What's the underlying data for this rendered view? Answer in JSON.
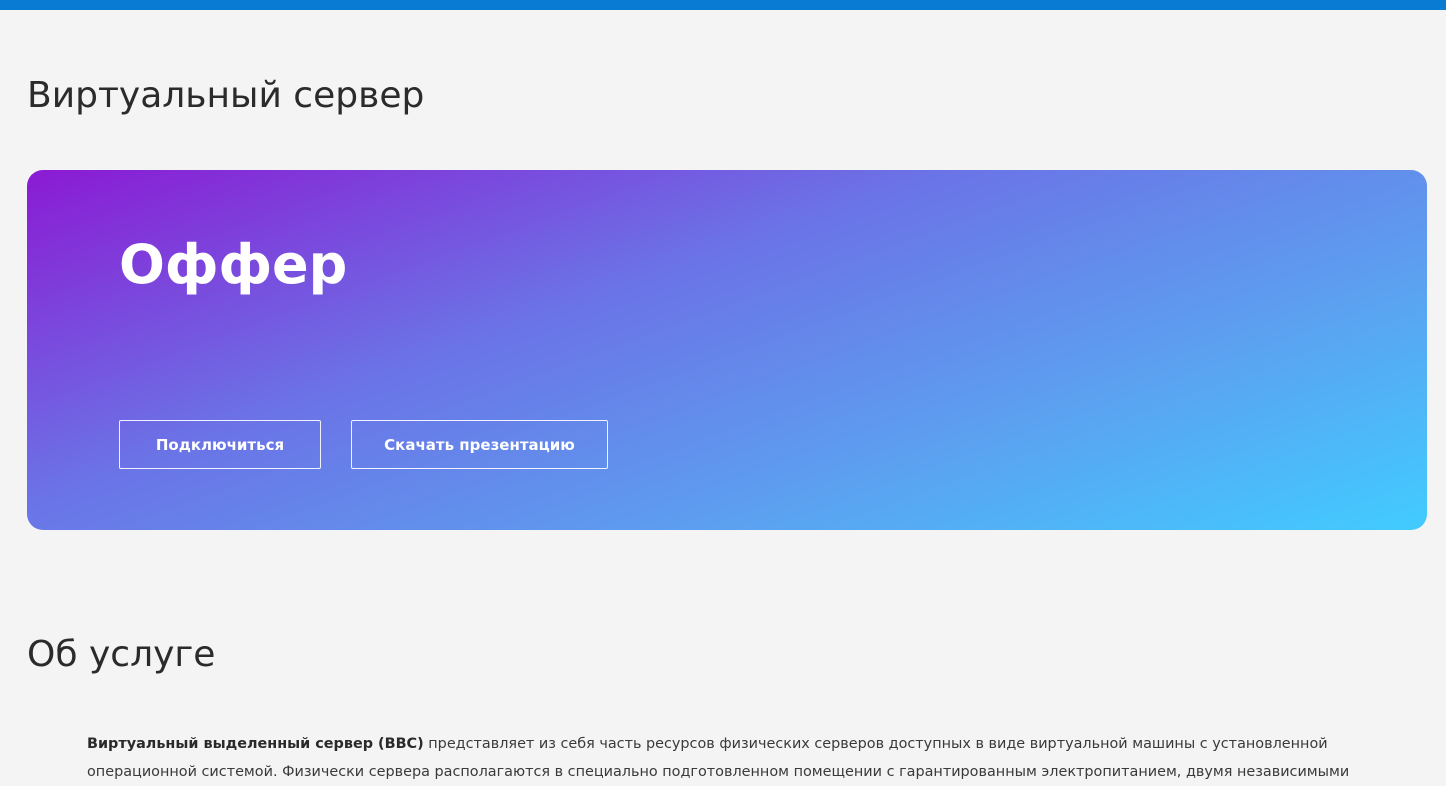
{
  "header": {
    "accent_color": "#0a7bd2"
  },
  "page": {
    "title": "Виртуальный сервер"
  },
  "offer": {
    "title": "Оффер",
    "connect_label": "Подключиться",
    "download_label": "Скачать презентацию",
    "gradient_colors": [
      "#8b1ad3",
      "#6b73e6",
      "#5ca0f0",
      "#41ccff"
    ]
  },
  "about": {
    "title": "Об услуге",
    "lead_bold": "Виртуальный выделенный сервер (ВВС)",
    "lead_text": " представляет из себя часть ресурсов физических серверов доступных в виде виртуальной машины с установленной операционной системой. Физически сервера располагаются в специально подготовленном помещении с гарантированным электропитанием, двумя независимыми"
  }
}
